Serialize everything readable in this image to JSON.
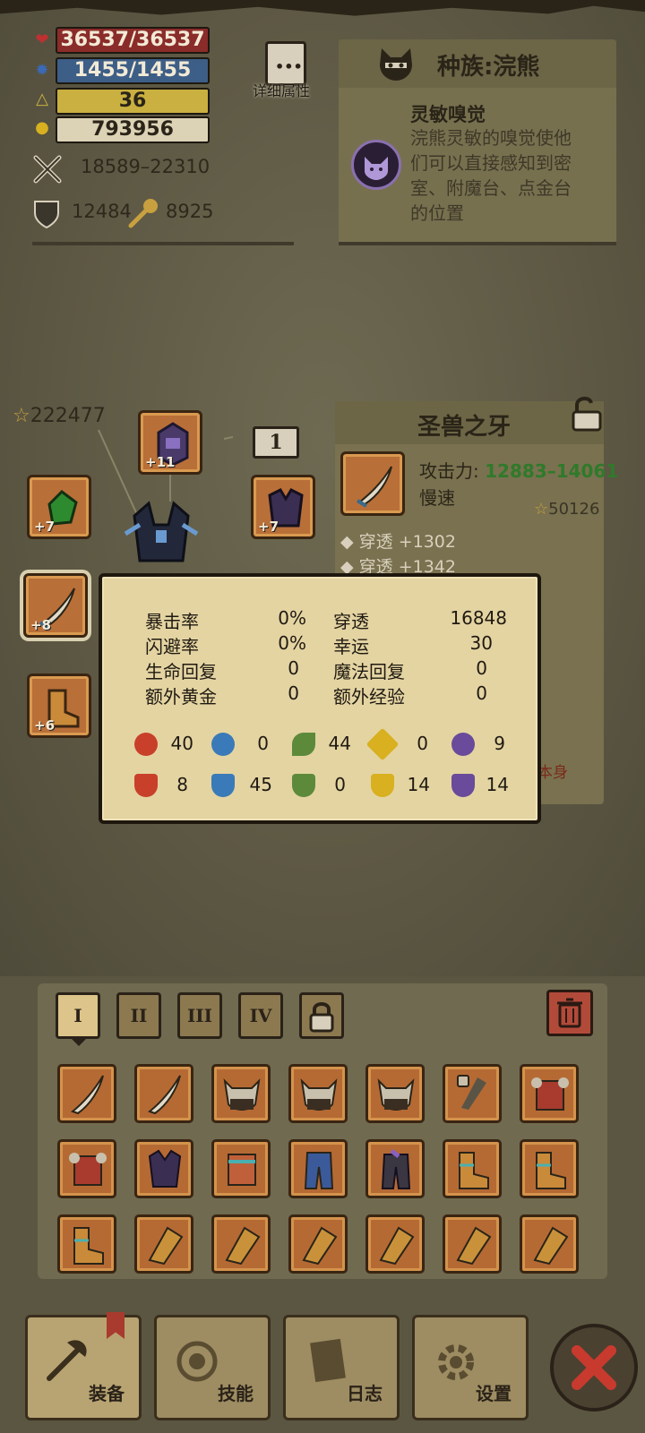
{
  "stats": {
    "hp": "36537/36537",
    "mp": "1455/1455",
    "level": "36",
    "gold": "793956",
    "attack_range": "18589–22310",
    "defense": "12484",
    "magic": "8925"
  },
  "detail_button_label": "详细属性",
  "race": {
    "title": "种族:浣熊",
    "skill_name": "灵敏嗅觉",
    "skill_desc": "浣熊灵敏的嗅觉使他们可以直接感知到密室、附魔台、点金台的位置"
  },
  "equipment": {
    "power": "222477",
    "floor_label": "1",
    "slots": [
      {
        "name": "helmet",
        "badge": "+11"
      },
      {
        "name": "gloves",
        "badge": "+7"
      },
      {
        "name": "armor",
        "badge": "+7"
      },
      {
        "name": "weapon",
        "badge": "+8"
      },
      {
        "name": "boots",
        "badge": "+6"
      }
    ]
  },
  "item": {
    "name": "圣兽之牙",
    "attack_label": "攻击力:",
    "attack_value": "12883–14061",
    "speed": "慢速",
    "score": "50126",
    "affixes": [
      "穿透 +1302",
      "穿透 +1342"
    ],
    "side_text": "本身"
  },
  "tooltip": {
    "rows": [
      {
        "l_label": "暴击率",
        "l_val": "0%",
        "r_label": "穿透",
        "r_val": "16848"
      },
      {
        "l_label": "闪避率",
        "l_val": "0%",
        "r_label": "幸运",
        "r_val": "30"
      },
      {
        "l_label": "生命回复",
        "l_val": "0",
        "r_label": "魔法回复",
        "r_val": "0"
      },
      {
        "l_label": "额外黄金",
        "l_val": "0",
        "r_label": "额外经验",
        "r_val": "0"
      }
    ],
    "elem_attack": [
      "40",
      "0",
      "44",
      "0",
      "9"
    ],
    "elem_defense": [
      "8",
      "45",
      "0",
      "14",
      "14"
    ]
  },
  "inventory": {
    "tabs": [
      "I",
      "II",
      "III",
      "IV"
    ]
  },
  "nav": {
    "equip": "装备",
    "skills": "技能",
    "log": "日志",
    "settings": "设置"
  },
  "colors": {
    "hp": "#8a2c2a",
    "mp": "#3d5e86",
    "level": "#c9b040",
    "attack_value": "#2f7a2a",
    "fire": "#c8402a",
    "water": "#3a7ab8",
    "nature": "#5c8a3a",
    "light": "#d8b020",
    "dark": "#6a4a9a"
  }
}
